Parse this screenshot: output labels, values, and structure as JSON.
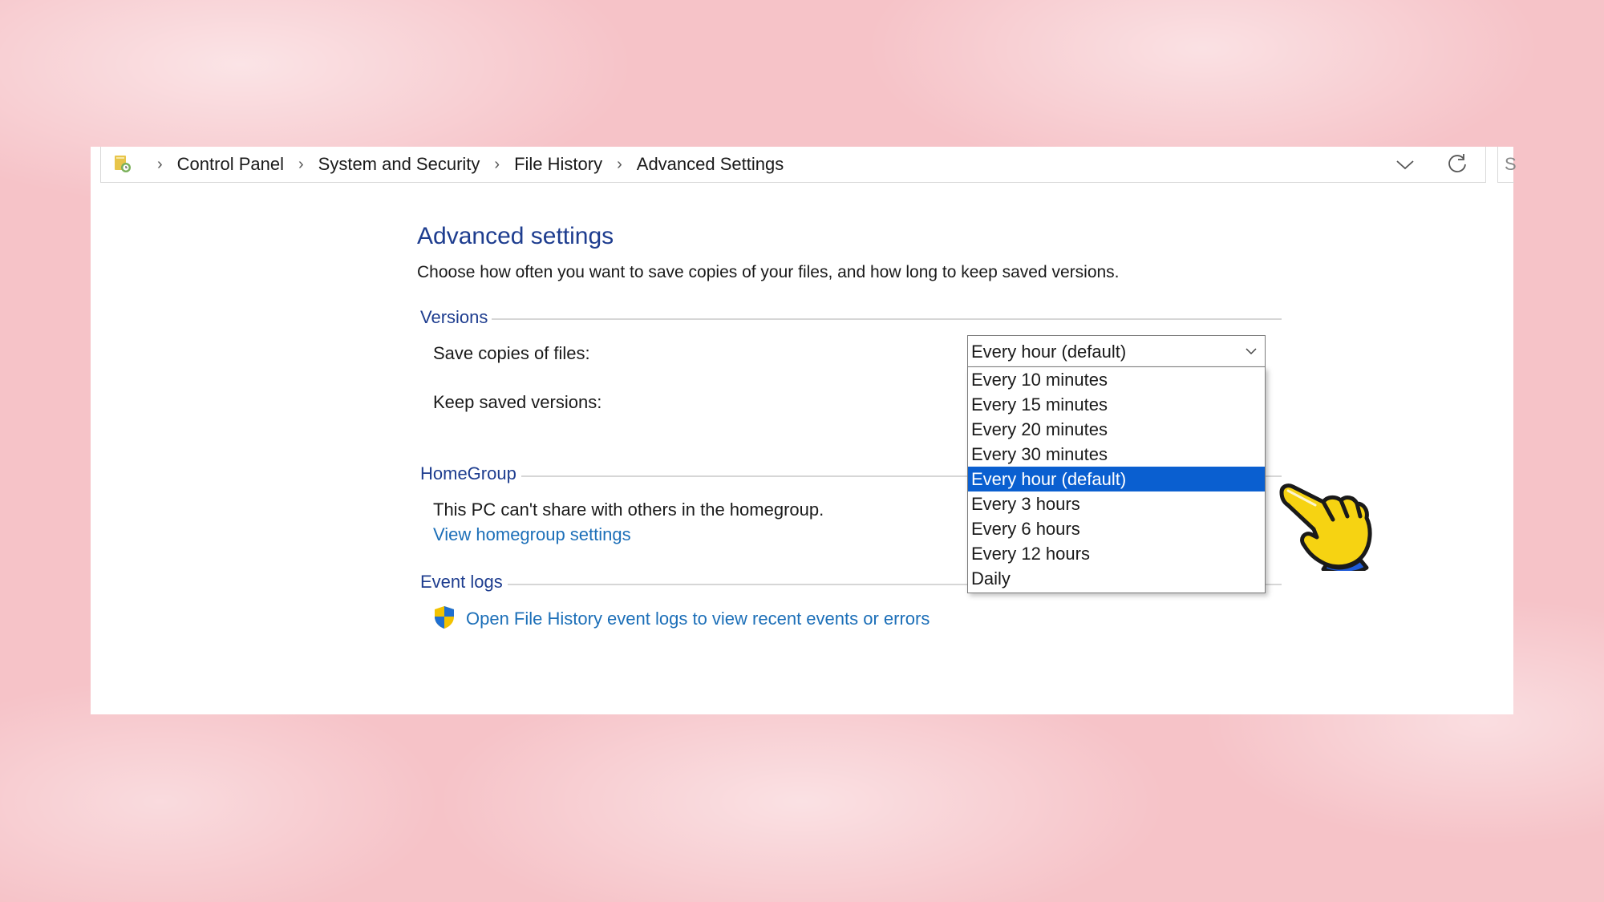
{
  "breadcrumb": {
    "items": [
      "Control Panel",
      "System and Security",
      "File History",
      "Advanced Settings"
    ],
    "separator": "›",
    "search_stub": "S"
  },
  "page": {
    "title": "Advanced settings",
    "description": "Choose how often you want to save copies of your files, and how long to keep saved versions."
  },
  "versions": {
    "heading": "Versions",
    "save_copies_label": "Save copies of files:",
    "keep_versions_label": "Keep saved versions:",
    "save_copies_value": "Every hour (default)",
    "options": [
      "Every 10 minutes",
      "Every 15 minutes",
      "Every 20 minutes",
      "Every 30 minutes",
      "Every hour (default)",
      "Every 3 hours",
      "Every 6 hours",
      "Every 12 hours",
      "Daily"
    ],
    "selected_index": 4
  },
  "homegroup": {
    "heading": "HomeGroup",
    "message": "This PC can't share with others in the homegroup.",
    "link": "View homegroup settings"
  },
  "event_logs": {
    "heading": "Event logs",
    "link": "Open File History event logs to view recent events or errors"
  },
  "colors": {
    "heading_blue": "#1e3d8f",
    "link_blue": "#1c6fb8",
    "selection_blue": "#0a5fd0",
    "background_pink": "#f6c3c8"
  },
  "icons": {
    "address": "file-history-icon",
    "shield": "uac-shield-icon",
    "pointer": "pointing-hand-icon"
  }
}
